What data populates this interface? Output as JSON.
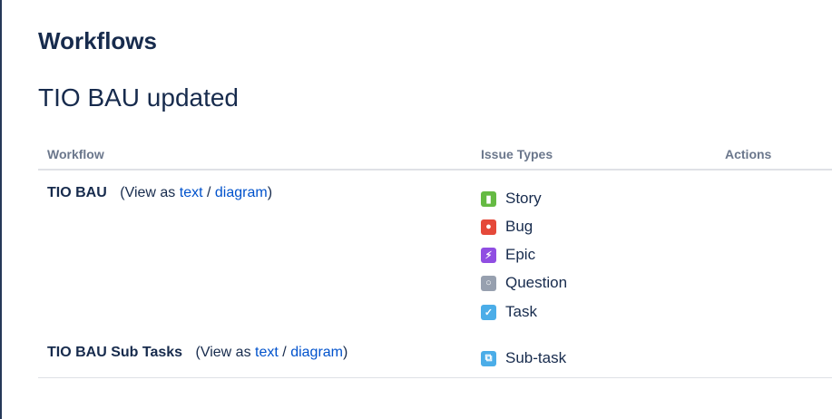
{
  "page_title": "Workflows",
  "scheme_title": "TIO BAU updated",
  "columns": {
    "workflow": "Workflow",
    "issue_types": "Issue Types",
    "actions": "Actions"
  },
  "rows": [
    {
      "name": "TIO BAU",
      "view_prefix": "(View as",
      "text_link": "text",
      "sep": "/",
      "diagram_link": "diagram",
      "close": ")",
      "issue_types": [
        {
          "label": "Story",
          "icon": "story-icon",
          "color": "#65ba43"
        },
        {
          "label": "Bug",
          "icon": "bug-icon",
          "color": "#e5493a"
        },
        {
          "label": "Epic",
          "icon": "epic-icon",
          "color": "#904ee2"
        },
        {
          "label": "Question",
          "icon": "question-icon",
          "color": "#97a0af"
        },
        {
          "label": "Task",
          "icon": "task-icon",
          "color": "#4bade8"
        }
      ]
    },
    {
      "name": "TIO BAU Sub Tasks",
      "view_prefix": "(View as",
      "text_link": "text",
      "sep": "/",
      "diagram_link": "diagram",
      "close": ")",
      "issue_types": [
        {
          "label": "Sub-task",
          "icon": "subtask-icon",
          "color": "#4bade8"
        }
      ]
    }
  ]
}
